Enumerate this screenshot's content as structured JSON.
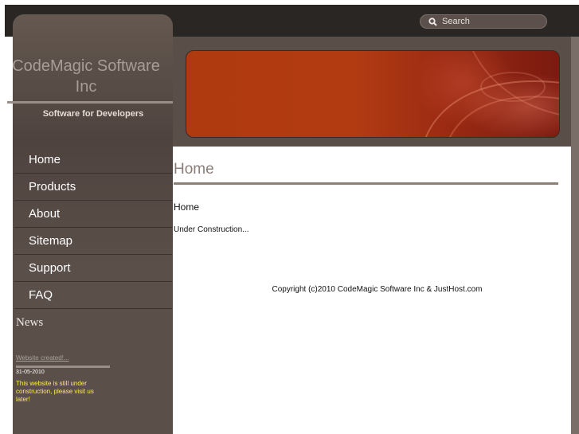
{
  "header": {
    "search": {
      "placeholder": "Search",
      "icon": "search-icon"
    }
  },
  "site": {
    "title": "CodeMagic Software Inc",
    "tagline": "Software for Developers"
  },
  "nav": {
    "items": [
      {
        "label": "Home"
      },
      {
        "label": "Products"
      },
      {
        "label": "About"
      },
      {
        "label": "Sitemap"
      },
      {
        "label": "Support"
      },
      {
        "label": "FAQ"
      }
    ]
  },
  "news": {
    "heading": "News",
    "item": {
      "title": "Website created!...",
      "date": "31-05-2010",
      "text": "This website is still under construction, please visit us later!"
    }
  },
  "main": {
    "page_title": "Home",
    "content_heading": "Home",
    "content_text": "Under Construction..."
  },
  "footer": {
    "copyright": "Copyright (c)2010 CodeMagic Software Inc & JustHost.com"
  },
  "colors": {
    "topbar": "#2a2624",
    "sidebar": "#5b4f49",
    "banner_accent": "#b23b12",
    "news_text": "#ffee44"
  }
}
